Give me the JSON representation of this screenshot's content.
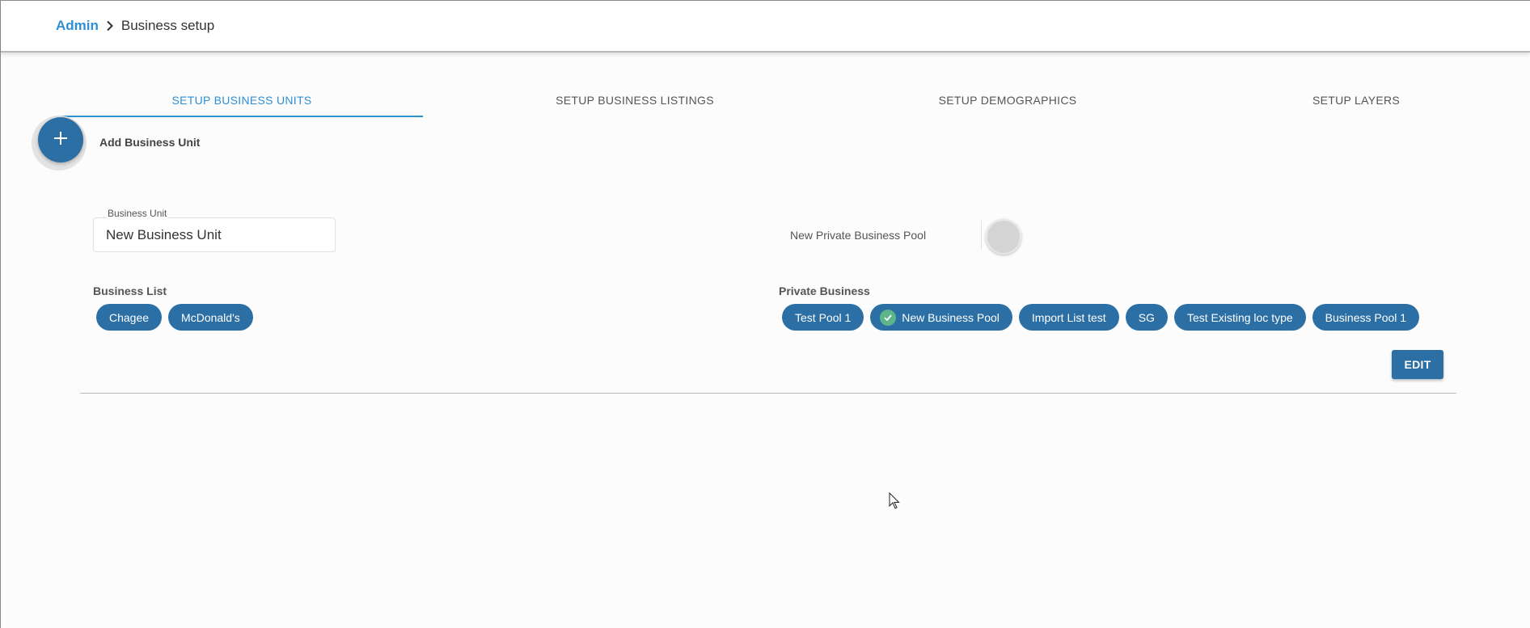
{
  "breadcrumb": {
    "root": "Admin",
    "current": "Business setup"
  },
  "tabs": [
    {
      "label": "SETUP BUSINESS UNITS",
      "active": true
    },
    {
      "label": "SETUP BUSINESS LISTINGS",
      "active": false
    },
    {
      "label": "SETUP DEMOGRAPHICS",
      "active": false
    },
    {
      "label": "SETUP LAYERS",
      "active": false
    }
  ],
  "add_unit": {
    "icon": "plus-icon",
    "label": "Add Business Unit"
  },
  "business_unit": {
    "label": "Business Unit",
    "value": "New Business Unit"
  },
  "private_pool": {
    "label": "New Private Business Pool",
    "enabled": false
  },
  "business_list": {
    "label": "Business List",
    "items": [
      "Chagee",
      "McDonald's"
    ]
  },
  "private_business": {
    "label": "Private Business",
    "items": [
      "Test Pool 1",
      "New Business Pool",
      "Import List test",
      "SG",
      "Test Existing loc type",
      "Business Pool 1"
    ],
    "selected": "New Business Pool"
  },
  "edit_button": "EDIT",
  "colors": {
    "accent": "#2f8fd3",
    "chip": "#2b6fa5",
    "check": "#5eb58a"
  }
}
